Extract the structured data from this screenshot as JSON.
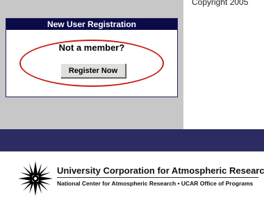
{
  "header": {
    "copyright": "Copyright 2005"
  },
  "registration": {
    "title": "New User Registration",
    "prompt": "Not a member?",
    "button_label": "Register Now"
  },
  "footer": {
    "org_name": "University Corporation for Atmospheric Research",
    "sub_line": "National Center for Atmospheric Research • UCAR Office of Programs",
    "logo_icon": "ucar-star-logo-icon"
  },
  "colors": {
    "panel_gray": "#c7c7c7",
    "header_navy": "#0b0b4a",
    "band_navy": "#2c2c63",
    "highlight_red": "#c8201c"
  }
}
